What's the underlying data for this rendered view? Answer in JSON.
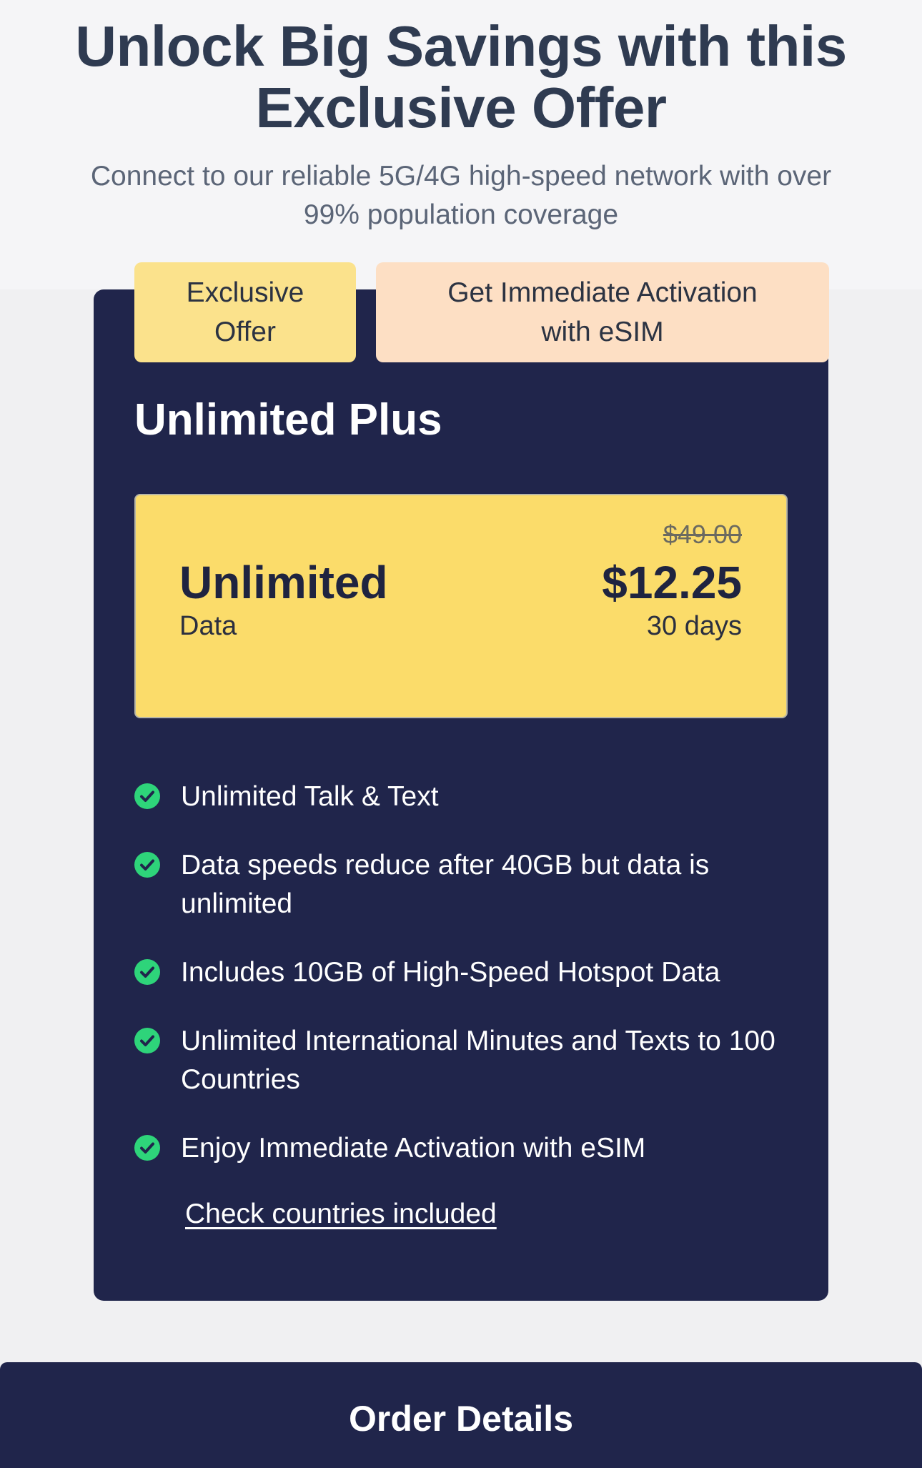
{
  "header": {
    "title": "Unlock Big Savings with this Exclusive Offer",
    "subtitle": "Connect to our reliable 5G/4G high-speed network with over 99% population coverage"
  },
  "tags": {
    "exclusive": "Exclusive Offer",
    "esim": "Get Immediate Activation with eSIM"
  },
  "plan": {
    "name": "Unlimited Plus",
    "data_amount": "Unlimited",
    "data_label": "Data",
    "original_price": "$49.00",
    "price": "$12.25",
    "period": "30 days",
    "features": [
      "Unlimited Talk & Text",
      "Data speeds reduce after 40GB but data is unlimited",
      "Includes 10GB of High-Speed Hotspot Data",
      "Unlimited International Minutes and Texts to 100 Countries",
      "Enjoy Immediate Activation with eSIM"
    ],
    "countries_link": "Check countries included"
  },
  "order": {
    "title": "Order Details"
  },
  "colors": {
    "card_bg": "#20254b",
    "price_box": "#fbdc6a",
    "tag_exclusive": "#fbe28c",
    "tag_esim": "#fddfc4",
    "check": "#2ed47a"
  },
  "icons": {
    "feature_check": "check-circle-icon"
  }
}
